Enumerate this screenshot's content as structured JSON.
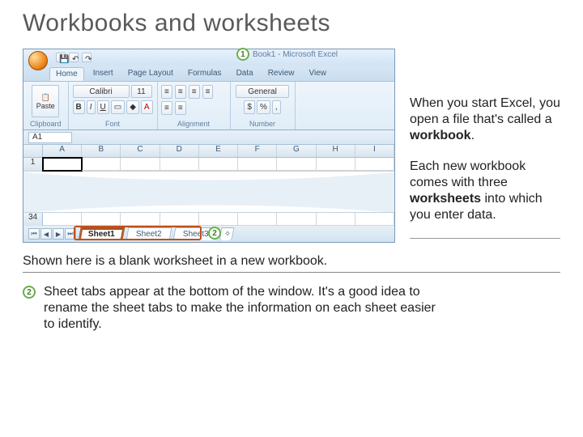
{
  "title": "Workbooks and worksheets",
  "excel": {
    "windowTitle": "Book1 - Microsoft Excel",
    "callout1": "1",
    "tabs": [
      "Home",
      "Insert",
      "Page Layout",
      "Formulas",
      "Data",
      "Review",
      "View"
    ],
    "activeTab": "Home",
    "groups": {
      "clipboard": {
        "label": "Clipboard",
        "paste": "Paste"
      },
      "font": {
        "label": "Font",
        "name": "Calibri",
        "size": "11"
      },
      "alignment": {
        "label": "Alignment"
      },
      "number": {
        "label": "Number",
        "format": "General"
      }
    },
    "nameBox": "A1",
    "columns": [
      "A",
      "B",
      "C",
      "D",
      "E",
      "F",
      "G",
      "H",
      "I"
    ],
    "rows": [
      "1",
      "34"
    ],
    "sheets": [
      "Sheet1",
      "Sheet2",
      "Sheet3"
    ],
    "callout2": "2"
  },
  "right": {
    "p1a": "When you start Excel, you open a file that's called a ",
    "p1b": "workbook",
    "p1c": ".",
    "p2a": "Each new workbook comes with three ",
    "p2b": "worksheets",
    "p2c": " into which you enter data."
  },
  "lower": {
    "lead": "Shown here is a blank worksheet in a new workbook.",
    "bulletNum": "2",
    "bullet": "Sheet tabs appear at the bottom of the window. It's a good idea to rename the sheet tabs to make the information on each sheet easier to identify."
  }
}
